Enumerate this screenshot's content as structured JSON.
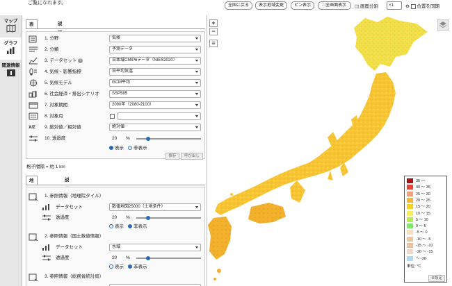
{
  "topbar": {
    "intro_text": "ご覧になれます。",
    "btn_full_country": "全国に戻る",
    "btn_region_change": "表示地域変更",
    "btn_pin": "ピン表示",
    "btn_fullscreen": "全画面表示",
    "split_label": "画面分割",
    "split_value": "×1",
    "sync_label": "位置を同期"
  },
  "leftnav": {
    "items": [
      {
        "label": "マップ",
        "icon": "map-icon"
      },
      {
        "label": "グラフ",
        "icon": "graph-icon"
      },
      {
        "label": "関連情報",
        "icon": "info-icon"
      }
    ]
  },
  "panel": {
    "tab1": "表示項目",
    "tab2": "説明",
    "rows": [
      {
        "label": "1. 分野",
        "value": "気候",
        "icon": "field-icon"
      },
      {
        "label": "2. 分類",
        "value": "予測データ",
        "icon": "category-icon"
      },
      {
        "label": "3. データセット",
        "value": "日本域CMIP6データ（NIES2020）",
        "icon": "dataset-icon"
      },
      {
        "label": "4. 気候・影響指標",
        "value": "日平均気温",
        "icon": "indicator-icon"
      },
      {
        "label": "5. 気候モデル",
        "value": "GCM平均",
        "icon": "model-icon"
      },
      {
        "label": "6. 社会経済・排出シナリオ",
        "value": "SSP585",
        "icon": "scenario-icon"
      },
      {
        "label": "7. 対象期間",
        "value": "2090年（2080-2100）",
        "icon": "period-icon"
      },
      {
        "label": "8. 対象月",
        "value": "",
        "icon": "month-icon"
      },
      {
        "label": "9. 絶対値／相対値",
        "value": "絶対値",
        "icon": "absrel-icon"
      }
    ],
    "transparency_label": "10. 透過度",
    "transparency_value": "20",
    "transparency_unit": "%",
    "radio_show": "表示",
    "radio_hide": "非表示",
    "btn_save": "保存",
    "btn_load": "呼び出し",
    "grid_spacing": "格子間隔 = 約 1 km",
    "tab3": "地図情報表示",
    "tab4": "説明",
    "ref1_label": "1. 参照情報（地理院タイル）",
    "ref1_dataset_label": "データセット",
    "ref1_dataset_value": "数値地図25000（土地条件）",
    "ref1_transparency_label": "透過度",
    "ref1_transparency_value": "20",
    "ref1_transparency_unit": "%",
    "ref1_radio_show": "表示",
    "ref1_radio_hide": "非表示",
    "ref2_label": "2. 参照情報（国土数値情報）",
    "ref2_dataset_label": "データセット",
    "ref2_dataset_value": "水域",
    "ref2_transparency_label": "透過度",
    "ref2_transparency_value": "20",
    "ref2_transparency_unit": "%",
    "ref2_radio_show": "表示",
    "ref2_radio_hide": "非表示",
    "ref3_label": "3. 参照情報（総務省統計局）"
  },
  "map": {
    "zoom_in": "+",
    "zoom_out": "−",
    "menu": "≡",
    "legend": {
      "entries": [
        {
          "label": "35 〜",
          "color": "#a30f14"
        },
        {
          "label": "30 〜 35",
          "color": "#e8443a"
        },
        {
          "label": "25 〜 30",
          "color": "#f4a07e"
        },
        {
          "label": "20 〜 25",
          "color": "#f7b733"
        },
        {
          "label": "15 〜 20",
          "color": "#f6d31f"
        },
        {
          "label": "10 〜 15",
          "color": "#f8ee5a"
        },
        {
          "label": "5 〜 10",
          "color": "#b6ec52"
        },
        {
          "label": "0 〜 5",
          "color": "#7be86a"
        },
        {
          "label": "-5 〜 0",
          "color": "#f6dfc0"
        },
        {
          "label": "-10 〜 -5",
          "color": "#ecc89b"
        },
        {
          "label": "-15 〜 -10",
          "color": "#e9c1a0"
        },
        {
          "label": "-20 〜 -15",
          "color": "#f2d8c8"
        },
        {
          "label": "〜 -20",
          "color": "#aedcf1"
        }
      ],
      "unit": "単位: ℃",
      "settings": "設定"
    }
  }
}
